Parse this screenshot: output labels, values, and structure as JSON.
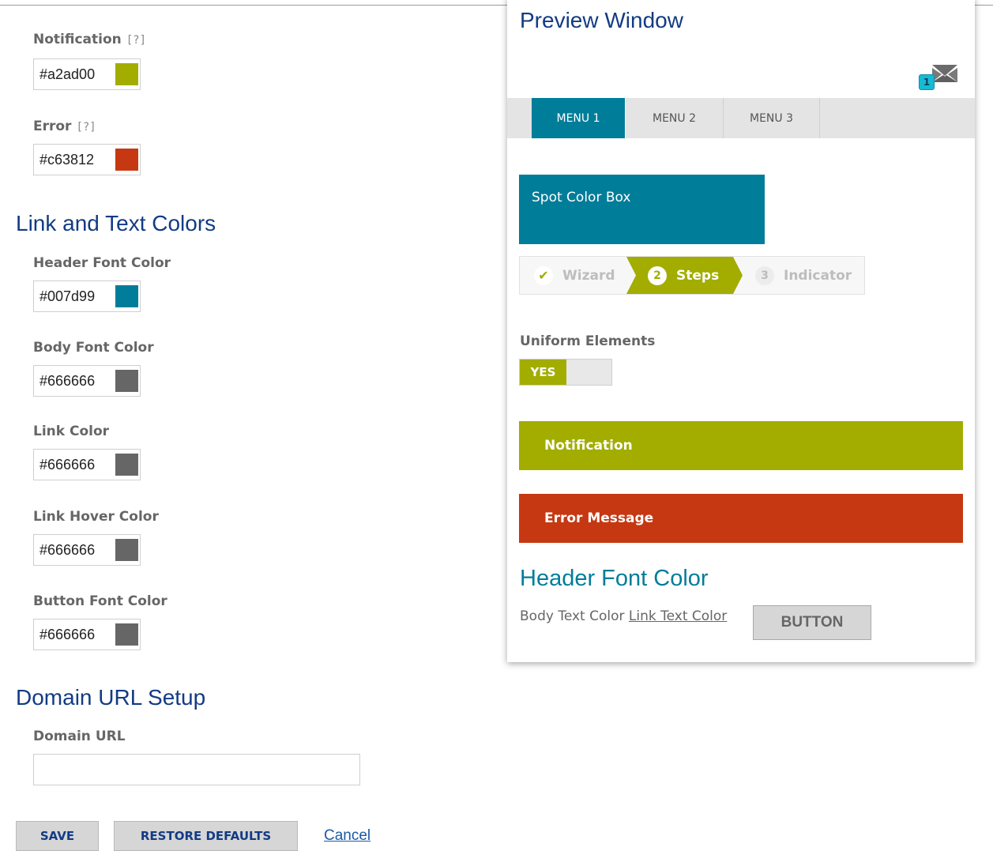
{
  "colors": {
    "header_font": "#007d99",
    "notification": "#a2ad00",
    "error": "#c63812",
    "body_font": "#666666",
    "section_heading": "#123b84"
  },
  "form": {
    "help_marker": "[?]",
    "notification": {
      "label": "Notification",
      "value": "#a2ad00"
    },
    "error": {
      "label": "Error",
      "value": "#c63812"
    },
    "link_text_section": "Link and Text Colors",
    "header_font_color": {
      "label": "Header Font Color",
      "value": "#007d99"
    },
    "body_font_color": {
      "label": "Body Font Color",
      "value": "#666666"
    },
    "link_color": {
      "label": "Link Color",
      "value": "#666666"
    },
    "link_hover_color": {
      "label": "Link Hover Color",
      "value": "#666666"
    },
    "button_font_color": {
      "label": "Button Font Color",
      "value": "#666666"
    },
    "domain_section": "Domain URL Setup",
    "domain_url": {
      "label": "Domain URL",
      "value": ""
    }
  },
  "actions": {
    "save": "SAVE",
    "restore": "RESTORE DEFAULTS",
    "cancel": "Cancel"
  },
  "preview": {
    "title": "Preview Window",
    "mail_icon": "envelope-icon",
    "mail_count": "1",
    "menu": [
      {
        "label": "MENU 1",
        "active": true
      },
      {
        "label": "MENU 2",
        "active": false
      },
      {
        "label": "MENU 3",
        "active": false
      }
    ],
    "spot_box": "Spot Color Box",
    "wizard": {
      "step1_icon": "checkmark-icon",
      "step1": "Wizard",
      "step2_num": "2",
      "step2": "Steps",
      "step3_num": "3",
      "step3": "Indicator"
    },
    "uniform_label": "Uniform Elements",
    "toggle_on": "YES",
    "notification_bar": "Notification",
    "error_bar": "Error Message",
    "header_font_text": "Header Font Color",
    "body_text": "Body Text Color",
    "link_text": "Link Text Color",
    "button_text": "BUTTON"
  }
}
